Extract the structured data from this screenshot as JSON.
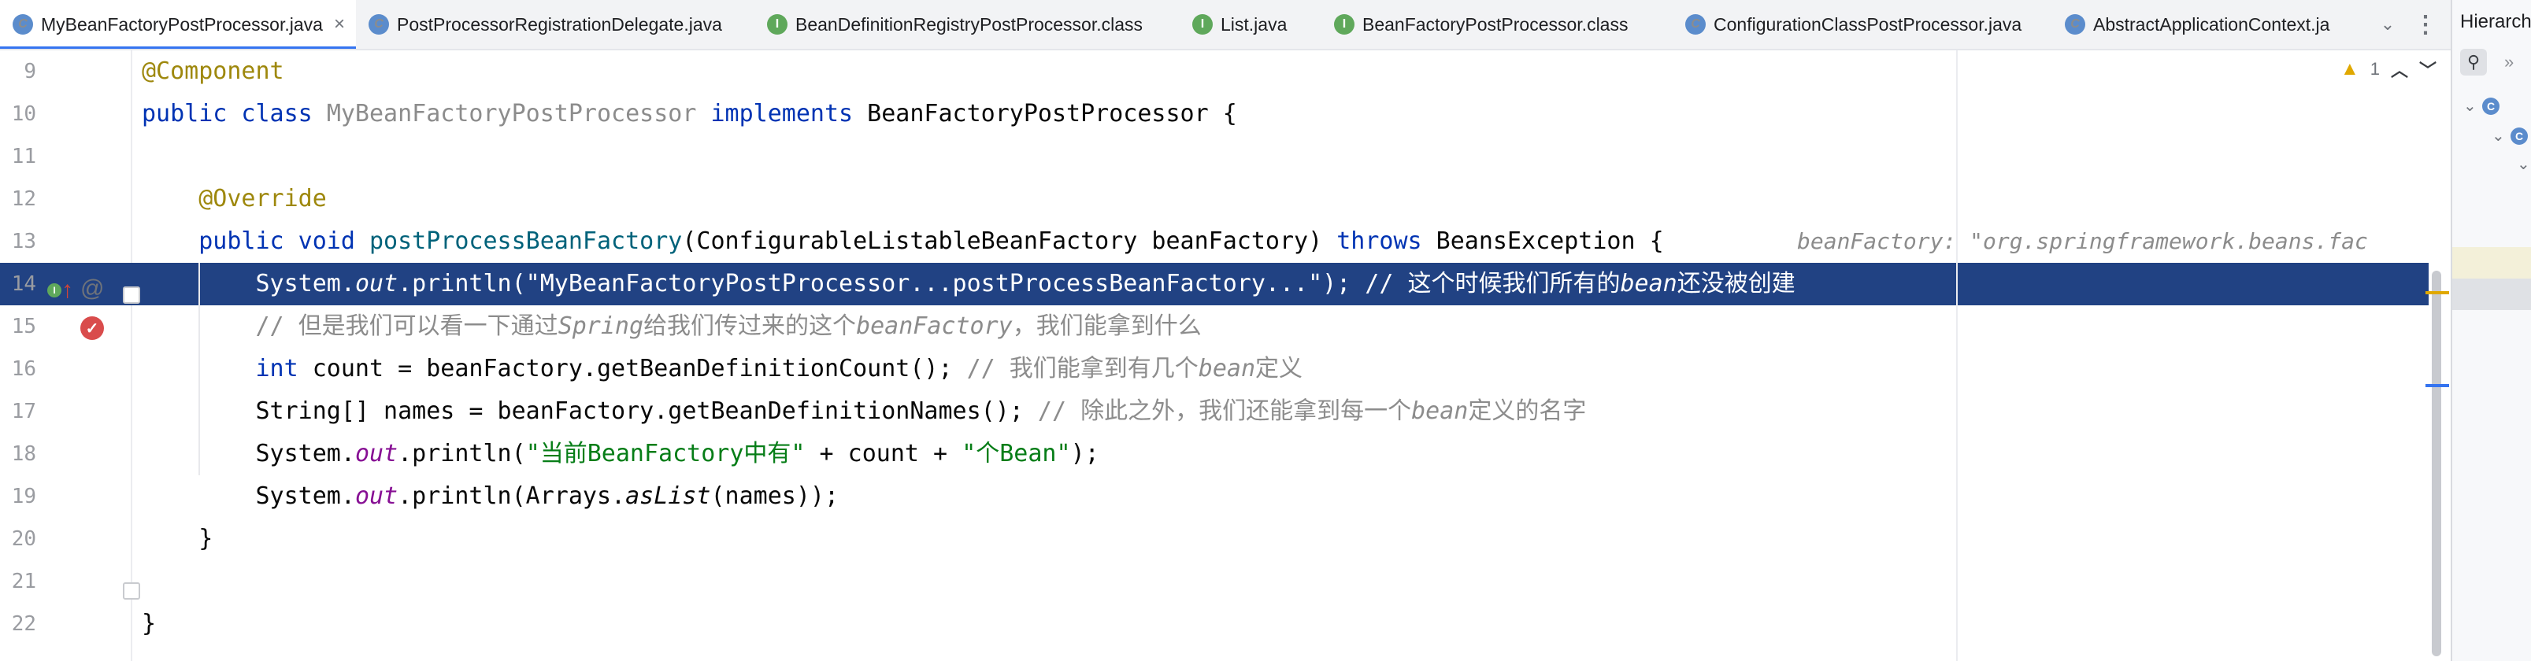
{
  "tabs": [
    {
      "label": "MyBeanFactoryPostProcessor.java",
      "icon": "class-icon",
      "kind": "C",
      "active": true,
      "closable": true
    },
    {
      "label": "PostProcessorRegistrationDelegate.java",
      "icon": "class-icon",
      "kind": "C",
      "active": false,
      "closable": false
    },
    {
      "label": "BeanDefinitionRegistryPostProcessor.class",
      "icon": "interface-icon",
      "kind": "I",
      "active": false,
      "closable": false
    },
    {
      "label": "List.java",
      "icon": "interface-icon",
      "kind": "I",
      "active": false,
      "closable": false
    },
    {
      "label": "BeanFactoryPostProcessor.class",
      "icon": "interface-icon",
      "kind": "I",
      "active": false,
      "closable": false
    },
    {
      "label": "ConfigurationClassPostProcessor.java",
      "icon": "class-icon",
      "kind": "C",
      "active": false,
      "closable": false
    },
    {
      "label": "AbstractApplicationContext.ja",
      "icon": "class-icon",
      "kind": "C",
      "active": false,
      "closable": false
    }
  ],
  "tab_overflow_label": "⌄",
  "tab_menu_label": "⋮",
  "right_panel": {
    "title": "Hierarch",
    "more_label": "»"
  },
  "inspection": {
    "warning_icon": "warning-icon",
    "warning_count": "1",
    "prev": "^",
    "next": "v"
  },
  "colors": {
    "selection": "#214283",
    "keyword": "#0033b3",
    "string": "#067d17",
    "comment": "#8c8c8c",
    "annotation": "#9e880d"
  },
  "lines": [
    {
      "num": "9",
      "segments": [
        {
          "t": "@Component",
          "c": "a"
        }
      ]
    },
    {
      "num": "10",
      "segments": [
        {
          "t": "public class ",
          "c": "k"
        },
        {
          "t": "MyBeanFactoryPostProcessor ",
          "c": "d"
        },
        {
          "t": "implements ",
          "c": "k"
        },
        {
          "t": "BeanFactoryPostProcessor {",
          "c": ""
        }
      ]
    },
    {
      "num": "11",
      "segments": []
    },
    {
      "num": "12",
      "segments": [
        {
          "t": "    ",
          "c": ""
        },
        {
          "t": "@Override",
          "c": "a"
        }
      ]
    },
    {
      "num": "13",
      "segments": [
        {
          "t": "    ",
          "c": ""
        },
        {
          "t": "public void ",
          "c": "k"
        },
        {
          "t": "postProcessBeanFactory",
          "c": "m"
        },
        {
          "t": "(ConfigurableListableBeanFactory beanFactory) ",
          "c": ""
        },
        {
          "t": "throws ",
          "c": "k"
        },
        {
          "t": "BeansException {",
          "c": ""
        }
      ],
      "hint": "beanFactory: \"org.springframework.beans.fac"
    },
    {
      "num": "14",
      "current": true,
      "segments": [
        {
          "t": "        System.",
          "c": ""
        },
        {
          "t": "out",
          "c": "it"
        },
        {
          "t": ".println(\"MyBeanFactoryPostProcessor...postProcessBeanFactory...\"); // 这个时候我们所有的",
          "c": ""
        },
        {
          "t": "bean",
          "c": "it"
        },
        {
          "t": "还没被创建",
          "c": ""
        }
      ]
    },
    {
      "num": "15",
      "segments": [
        {
          "t": "        ",
          "c": ""
        },
        {
          "t": "// 但是我们可以看一下通过",
          "c": "cn"
        },
        {
          "t": "Spring",
          "c": "c"
        },
        {
          "t": "给我们传过来的这个",
          "c": "cn"
        },
        {
          "t": "beanFactory",
          "c": "c"
        },
        {
          "t": "，我们能拿到什么",
          "c": "cn"
        }
      ]
    },
    {
      "num": "16",
      "segments": [
        {
          "t": "        ",
          "c": ""
        },
        {
          "t": "int ",
          "c": "k"
        },
        {
          "t": "count = beanFactory.getBeanDefinitionCount(); ",
          "c": ""
        },
        {
          "t": "// 我们能拿到有几个",
          "c": "cn"
        },
        {
          "t": "bean",
          "c": "c"
        },
        {
          "t": "定义",
          "c": "cn"
        }
      ]
    },
    {
      "num": "17",
      "segments": [
        {
          "t": "        String[] names = beanFactory.getBeanDefinitionNames(); ",
          "c": ""
        },
        {
          "t": "// 除此之外，我们还能拿到每一个",
          "c": "cn"
        },
        {
          "t": "bean",
          "c": "c"
        },
        {
          "t": "定义的名字",
          "c": "cn"
        }
      ]
    },
    {
      "num": "18",
      "segments": [
        {
          "t": "        System.",
          "c": ""
        },
        {
          "t": "out",
          "c": "f"
        },
        {
          "t": ".println(",
          "c": ""
        },
        {
          "t": "\"当前BeanFactory中有\"",
          "c": "s"
        },
        {
          "t": " + count + ",
          "c": ""
        },
        {
          "t": "\"个Bean\"",
          "c": "s"
        },
        {
          "t": ");",
          "c": ""
        }
      ]
    },
    {
      "num": "19",
      "segments": [
        {
          "t": "        System.",
          "c": ""
        },
        {
          "t": "out",
          "c": "f"
        },
        {
          "t": ".println(Arrays.",
          "c": ""
        },
        {
          "t": "asList",
          "c": "it"
        },
        {
          "t": "(names));",
          "c": ""
        }
      ]
    },
    {
      "num": "20",
      "segments": [
        {
          "t": "    }",
          "c": ""
        }
      ]
    },
    {
      "num": "21",
      "segments": []
    },
    {
      "num": "22",
      "segments": [
        {
          "t": "}",
          "c": ""
        }
      ]
    }
  ]
}
